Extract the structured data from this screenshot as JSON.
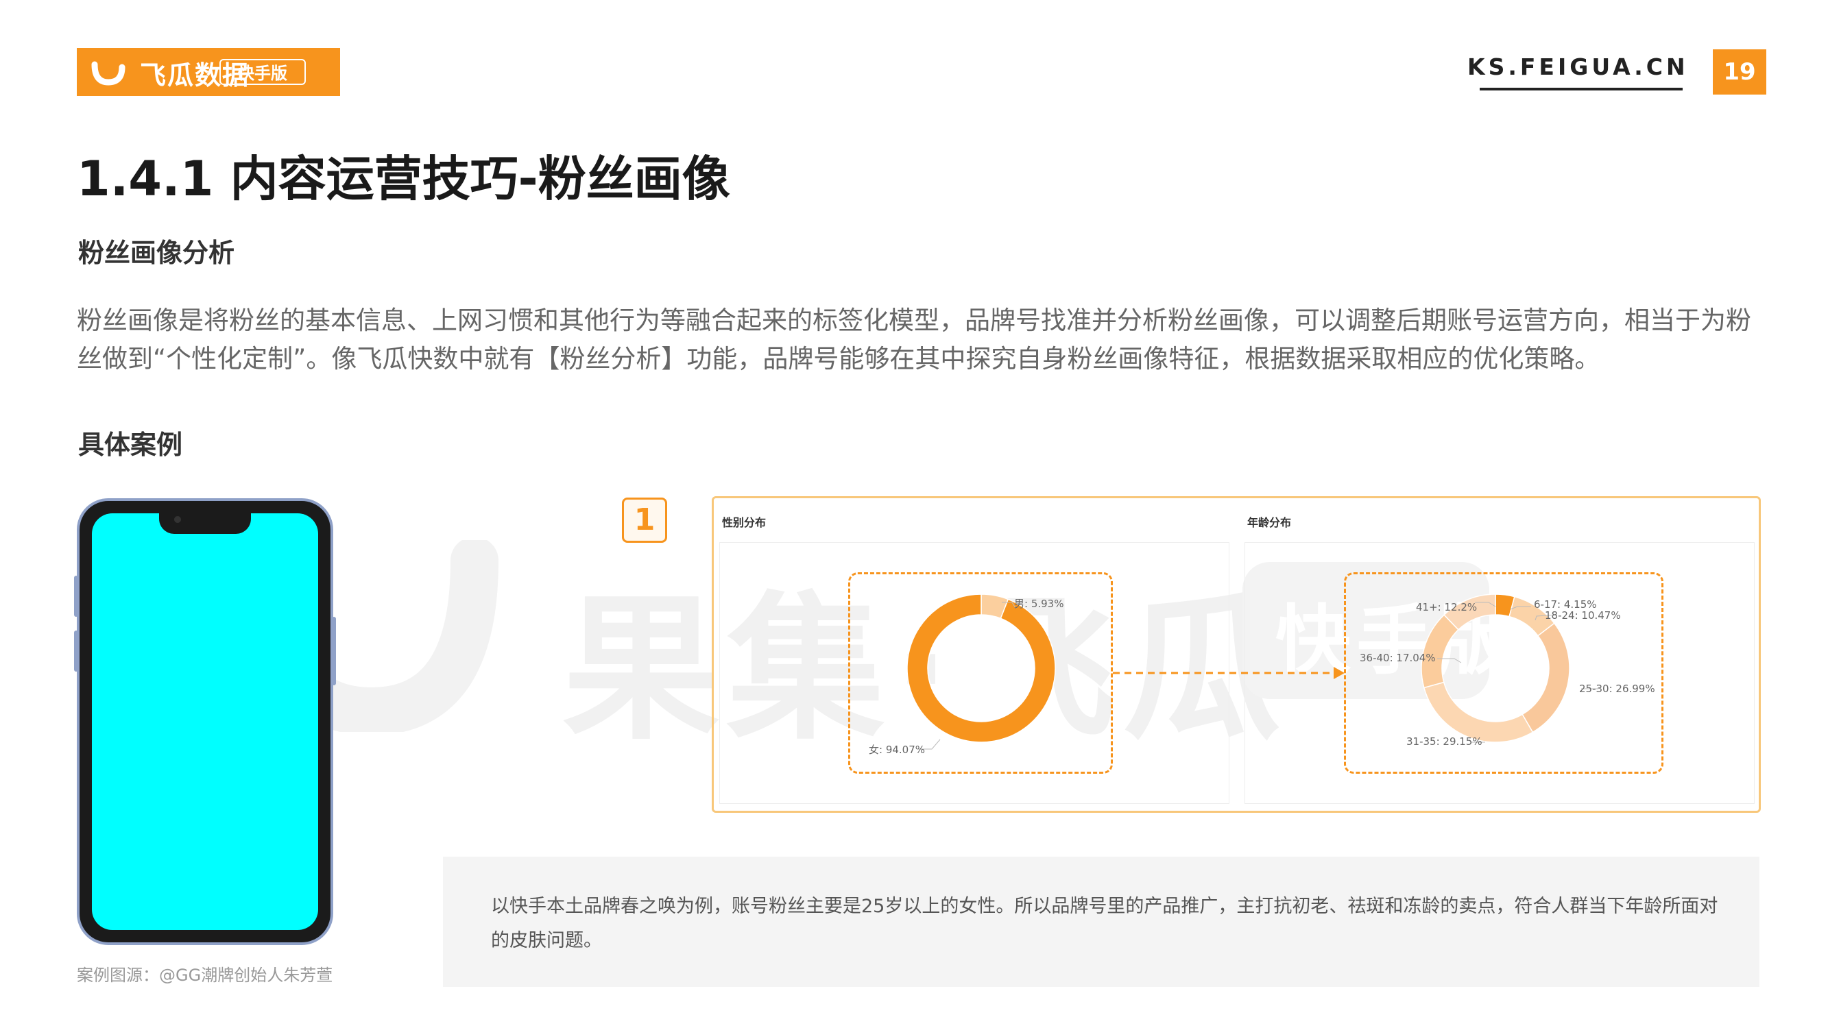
{
  "header": {
    "logo_text": "飞瓜数据",
    "logo_tag": "快手版",
    "site_url": "KS.FEIGUA.CN",
    "page_number": "19"
  },
  "title": "1.4.1 内容运营技巧-粉丝画像",
  "section1": {
    "heading": "粉丝画像分析",
    "paragraph": "粉丝画像是将粉丝的基本信息、上网习惯和其他行为等融合起来的标签化模型，品牌号找准并分析粉丝画像，可以调整后期账号运营方向，相当于为粉丝做到“个性化定制”。像飞瓜快数中就有【粉丝分析】功能，品牌号能够在其中探究自身粉丝画像特征，根据数据采取相应的优化策略。"
  },
  "section2": {
    "heading": "具体案例",
    "badge": "1",
    "credit": "案例图源：@GG潮牌创始人朱芳萱",
    "note": "以快手本土品牌春之唤为例，账号粉丝主要是25岁以上的女性。所以品牌号里的产品推广，主打抗初老、祛斑和冻龄的卖点，符合人群当下年龄所面对的皮肤问题。"
  },
  "watermark": {
    "text": "果集·飞瓜",
    "tag": "快手版"
  },
  "colors": {
    "brand": "#f7941d",
    "brand_light": "#f9c89b",
    "phone_screen": "#00ffff"
  },
  "chart_data": [
    {
      "type": "pie",
      "title": "性别分布",
      "categories": [
        "男",
        "女"
      ],
      "values": [
        5.93,
        94.07
      ],
      "labels": [
        "男: 5.93%",
        "女: 94.07%"
      ]
    },
    {
      "type": "pie",
      "title": "年龄分布",
      "categories": [
        "6-17",
        "18-24",
        "25-30",
        "31-35",
        "36-40",
        "41+"
      ],
      "values": [
        4.15,
        10.47,
        26.99,
        29.15,
        17.04,
        12.2
      ],
      "labels": [
        "6-17: 4.15%",
        "18-24: 10.47%",
        "25-30: 26.99%",
        "31-35: 29.15%",
        "36-40: 17.04%",
        "41+: 12.2%"
      ]
    }
  ]
}
